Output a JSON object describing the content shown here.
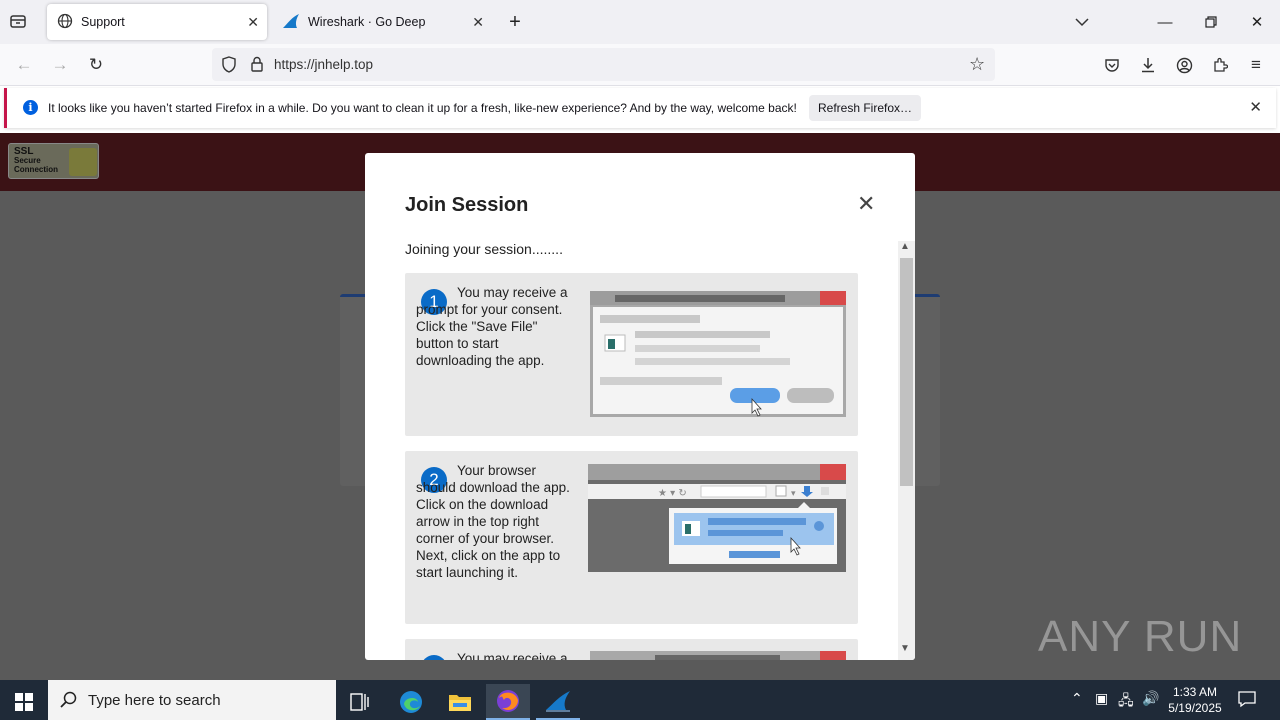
{
  "browser": {
    "tabs": [
      {
        "label": "Support",
        "active": true
      },
      {
        "label": "Wireshark · Go Deep",
        "active": false
      }
    ],
    "url": "https://jnhelp.top",
    "notification": {
      "message": "It looks like you haven’t started Firefox in a while. Do you want to clean it up for a fresh, like-new experience? And by the way, welcome back!",
      "button": "Refresh Firefox…"
    }
  },
  "page": {
    "ssl_badge": {
      "line1": "SSL",
      "line2": "Secure",
      "line3": "Connection"
    }
  },
  "modal": {
    "title": "Join Session",
    "subtitle": "Joining your session........",
    "steps": [
      {
        "number": "1",
        "text": "You may receive a prompt for your consent. Click the \"Save File\" button to start downloading the app."
      },
      {
        "number": "2",
        "text": "Your browser should download the app. Click on the download arrow in the top right corner of your browser. Next, click on the app to start launching it."
      },
      {
        "number": "3",
        "text": "You may receive a"
      }
    ]
  },
  "watermark": "ANY RUN",
  "taskbar": {
    "search_placeholder": "Type here to search",
    "time": "1:33 AM",
    "date": "5/19/2025"
  },
  "colors": {
    "accent_blue": "#0a6bc7",
    "header_dark_red": "#3b1215",
    "taskbar": "#1f2a38"
  }
}
